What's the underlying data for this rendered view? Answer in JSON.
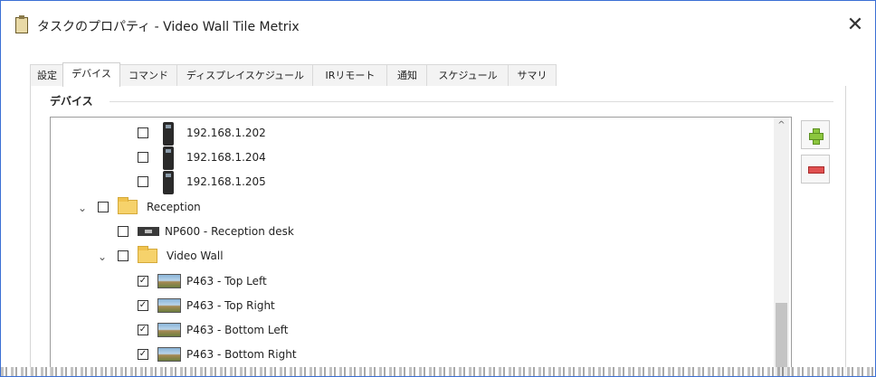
{
  "window": {
    "title": "タスクのプロパティ - Video Wall Tile Metrix",
    "close_glyph": "✕"
  },
  "tabs": [
    {
      "label": "設定",
      "active": false
    },
    {
      "label": "デバイス",
      "active": true
    },
    {
      "label": "コマンド",
      "active": false
    },
    {
      "label": "ディスプレイスケジュール",
      "active": false
    },
    {
      "label": "IRリモート",
      "active": false
    },
    {
      "label": "通知",
      "active": false
    },
    {
      "label": "スケジュール",
      "active": false
    },
    {
      "label": "サマリ",
      "active": false
    }
  ],
  "group": {
    "label": "デバイス"
  },
  "tree": {
    "rows": [
      {
        "label": "192.168.1.202",
        "icon": "device-icon",
        "checked": false,
        "expander": ""
      },
      {
        "label": "192.168.1.204",
        "icon": "device-icon",
        "checked": false,
        "expander": ""
      },
      {
        "label": "192.168.1.205",
        "icon": "device-icon",
        "checked": false,
        "expander": ""
      },
      {
        "label": "Reception",
        "icon": "folder-icon",
        "checked": false,
        "expander": "⌄"
      },
      {
        "label": "NP600 - Reception desk",
        "icon": "receiver-icon",
        "checked": false,
        "expander": ""
      },
      {
        "label": "Video Wall",
        "icon": "folder-icon",
        "checked": false,
        "expander": "⌄"
      },
      {
        "label": "P463 - Top Left",
        "icon": "display-icon",
        "checked": true,
        "expander": ""
      },
      {
        "label": "P463 - Top Right",
        "icon": "display-icon",
        "checked": true,
        "expander": ""
      },
      {
        "label": "P463 - Bottom Left",
        "icon": "display-icon",
        "checked": true,
        "expander": ""
      },
      {
        "label": "P463 - Bottom Right",
        "icon": "display-icon",
        "checked": true,
        "expander": ""
      }
    ],
    "check_glyph": "✓",
    "scroll_up_glyph": "^"
  },
  "buttons": {
    "add_icon": "plus-icon",
    "remove_icon": "minus-icon"
  },
  "colors": {
    "window_border": "#3b6fd4",
    "add_green": "#8cc63e",
    "remove_red": "#e05050"
  }
}
